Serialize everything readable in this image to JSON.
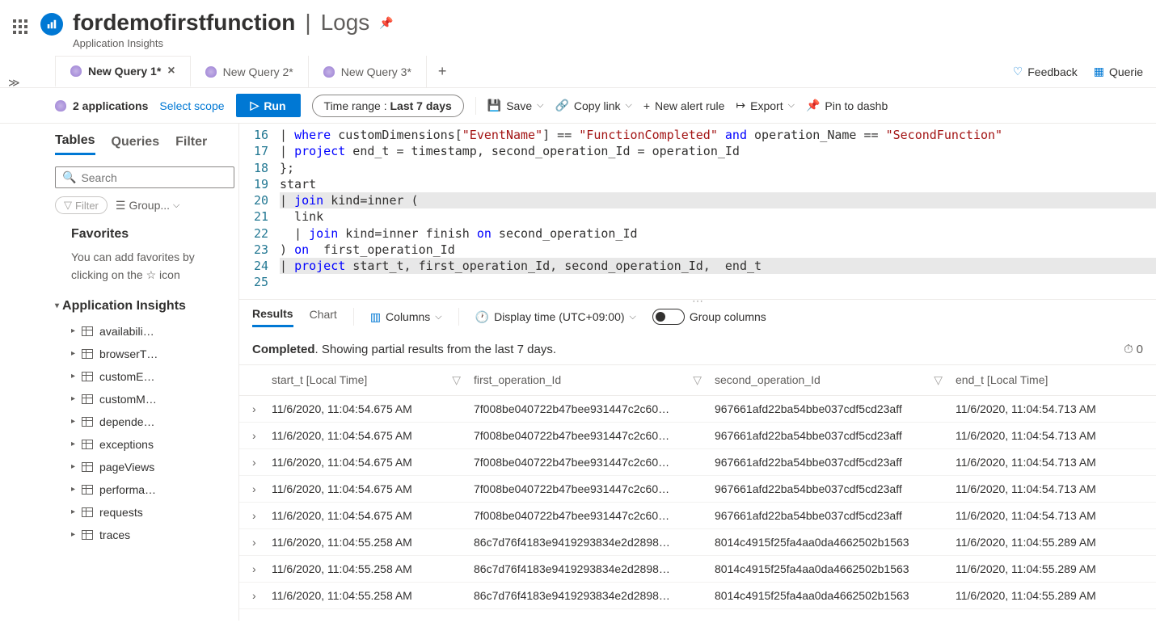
{
  "header": {
    "title": "fordemofirstfunction",
    "section": "Logs",
    "subtitle": "Application Insights"
  },
  "tabs": {
    "items": [
      {
        "label": "New Query 1*",
        "active": true
      },
      {
        "label": "New Query 2*",
        "active": false
      },
      {
        "label": "New Query 3*",
        "active": false
      }
    ],
    "feedback": "Feedback",
    "queries": "Querie"
  },
  "toolbar": {
    "apps_label": "2 applications",
    "scope": "Select scope",
    "run": "Run",
    "time_range_label": "Time range :",
    "time_range_value": "Last 7 days",
    "save": "Save",
    "copy_link": "Copy link",
    "new_alert": "New alert rule",
    "export": "Export",
    "pin": "Pin to dashb"
  },
  "sidebar": {
    "tabs": {
      "tables": "Tables",
      "queries": "Queries",
      "filter": "Filter"
    },
    "search_placeholder": "Search",
    "filter_pill": "Filter",
    "group": "Group...",
    "favorites_title": "Favorites",
    "favorites_text": "You can add favorites by clicking on the ☆ icon",
    "tree_title": "Application Insights",
    "tree_items": [
      "availabili…",
      "browserT…",
      "customE…",
      "customM…",
      "depende…",
      "exceptions",
      "pageViews",
      "performa…",
      "requests",
      "traces"
    ]
  },
  "editor": {
    "first_line": 16,
    "lines": [
      {
        "tokens": [
          {
            "t": "| ",
            "c": ""
          },
          {
            "t": "where",
            "c": "b"
          },
          {
            "t": " customDimensions[",
            "c": ""
          },
          {
            "t": "\"EventName\"",
            "c": "r"
          },
          {
            "t": "] == ",
            "c": ""
          },
          {
            "t": "\"FunctionCompleted\"",
            "c": "r"
          },
          {
            "t": " ",
            "c": ""
          },
          {
            "t": "and",
            "c": "b"
          },
          {
            "t": " operation_Name == ",
            "c": ""
          },
          {
            "t": "\"SecondFunction\"",
            "c": "r"
          }
        ]
      },
      {
        "tokens": [
          {
            "t": "| ",
            "c": ""
          },
          {
            "t": "project",
            "c": "b"
          },
          {
            "t": " end_t = timestamp, second_operation_Id = operation_Id",
            "c": ""
          }
        ]
      },
      {
        "tokens": [
          {
            "t": "};",
            "c": ""
          }
        ]
      },
      {
        "tokens": [
          {
            "t": "start",
            "c": ""
          }
        ]
      },
      {
        "tokens": [
          {
            "t": "| ",
            "c": ""
          },
          {
            "t": "join",
            "c": "b"
          },
          {
            "t": " kind=inner (",
            "c": ""
          }
        ],
        "hl": true
      },
      {
        "tokens": [
          {
            "t": "  link",
            "c": ""
          }
        ]
      },
      {
        "tokens": [
          {
            "t": "  | ",
            "c": ""
          },
          {
            "t": "join",
            "c": "b"
          },
          {
            "t": " kind=inner finish ",
            "c": ""
          },
          {
            "t": "on",
            "c": "b"
          },
          {
            "t": " second_operation_Id",
            "c": ""
          }
        ]
      },
      {
        "tokens": [
          {
            "t": ") ",
            "c": ""
          },
          {
            "t": "on",
            "c": "b"
          },
          {
            "t": "  first_operation_Id",
            "c": ""
          }
        ]
      },
      {
        "tokens": [
          {
            "t": "| ",
            "c": ""
          },
          {
            "t": "project",
            "c": "b"
          },
          {
            "t": " start_t, first_operation_Id, second_operation_Id,  end_t",
            "c": ""
          }
        ],
        "hl": true
      },
      {
        "tokens": []
      }
    ]
  },
  "results": {
    "tabs": {
      "results": "Results",
      "chart": "Chart"
    },
    "columns_btn": "Columns",
    "display_time": "Display time (UTC+09:00)",
    "group_columns": "Group columns",
    "status_bold": "Completed",
    "status_rest": ". Showing partial results from the last 7 days.",
    "duration": "0",
    "headers": [
      "start_t [Local Time]",
      "first_operation_Id",
      "second_operation_Id",
      "end_t [Local Time]"
    ],
    "rows": [
      {
        "start": "11/6/2020, 11:04:54.675 AM",
        "op1": "7f008be040722b47bee931447c2c60…",
        "op2": "967661afd22ba54bbe037cdf5cd23aff",
        "end": "11/6/2020, 11:04:54.713 AM"
      },
      {
        "start": "11/6/2020, 11:04:54.675 AM",
        "op1": "7f008be040722b47bee931447c2c60…",
        "op2": "967661afd22ba54bbe037cdf5cd23aff",
        "end": "11/6/2020, 11:04:54.713 AM"
      },
      {
        "start": "11/6/2020, 11:04:54.675 AM",
        "op1": "7f008be040722b47bee931447c2c60…",
        "op2": "967661afd22ba54bbe037cdf5cd23aff",
        "end": "11/6/2020, 11:04:54.713 AM"
      },
      {
        "start": "11/6/2020, 11:04:54.675 AM",
        "op1": "7f008be040722b47bee931447c2c60…",
        "op2": "967661afd22ba54bbe037cdf5cd23aff",
        "end": "11/6/2020, 11:04:54.713 AM"
      },
      {
        "start": "11/6/2020, 11:04:54.675 AM",
        "op1": "7f008be040722b47bee931447c2c60…",
        "op2": "967661afd22ba54bbe037cdf5cd23aff",
        "end": "11/6/2020, 11:04:54.713 AM"
      },
      {
        "start": "11/6/2020, 11:04:55.258 AM",
        "op1": "86c7d76f4183e9419293834e2d2898…",
        "op2": "8014c4915f25fa4aa0da4662502b1563",
        "end": "11/6/2020, 11:04:55.289 AM"
      },
      {
        "start": "11/6/2020, 11:04:55.258 AM",
        "op1": "86c7d76f4183e9419293834e2d2898…",
        "op2": "8014c4915f25fa4aa0da4662502b1563",
        "end": "11/6/2020, 11:04:55.289 AM"
      },
      {
        "start": "11/6/2020, 11:04:55.258 AM",
        "op1": "86c7d76f4183e9419293834e2d2898…",
        "op2": "8014c4915f25fa4aa0da4662502b1563",
        "end": "11/6/2020, 11:04:55.289 AM"
      }
    ]
  }
}
